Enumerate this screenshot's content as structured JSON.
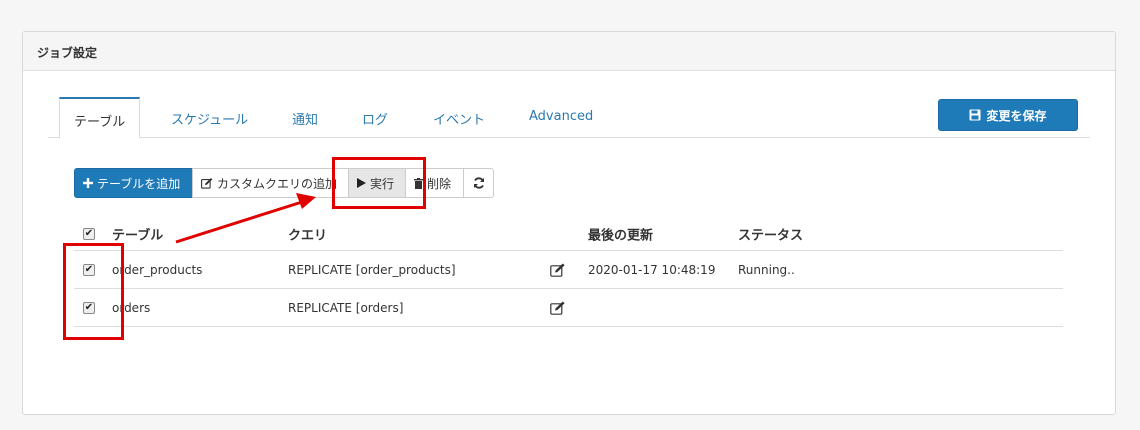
{
  "panel": {
    "title": "ジョブ設定"
  },
  "tabs": [
    {
      "label": "テーブル",
      "active": true
    },
    {
      "label": "スケジュール",
      "active": false
    },
    {
      "label": "通知",
      "active": false
    },
    {
      "label": "ログ",
      "active": false
    },
    {
      "label": "イベント",
      "active": false
    },
    {
      "label": "Advanced",
      "active": false
    }
  ],
  "save_button": {
    "label": "変更を保存",
    "icon": "floppy-disk-icon"
  },
  "toolbar": {
    "add_table": "テーブルを追加",
    "custom_query": "カスタムクエリの追加",
    "run": "実行",
    "delete": "削除",
    "refresh_icon": "refresh-icon"
  },
  "table": {
    "headers": {
      "table": "テーブル",
      "query": "クエリ",
      "last_updated": "最後の更新",
      "status": "ステータス"
    },
    "rows": [
      {
        "table": "order_products",
        "query": "REPLICATE [order_products]",
        "last_updated": "2020-01-17 10:48:19",
        "status": "Running..",
        "checked": true
      },
      {
        "table": "orders",
        "query": "REPLICATE [orders]",
        "last_updated": "",
        "status": "",
        "checked": true
      }
    ]
  },
  "colors": {
    "accent": "#1f7ab8",
    "annotation": "#e00000"
  }
}
